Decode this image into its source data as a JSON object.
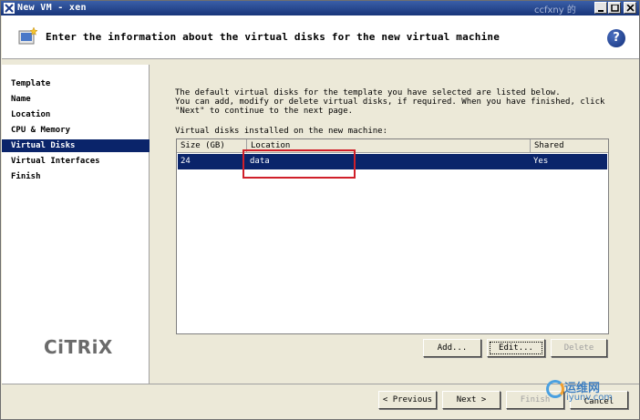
{
  "window": {
    "title": "New VM - xen",
    "watermark_top": "ccfxny 的"
  },
  "header": {
    "heading": "Enter the information about the virtual disks for the new virtual machine",
    "help_label": "?"
  },
  "nav": {
    "items": [
      {
        "label": "Template",
        "active": false
      },
      {
        "label": "Name",
        "active": false
      },
      {
        "label": "Location",
        "active": false
      },
      {
        "label": "CPU & Memory",
        "active": false
      },
      {
        "label": "Virtual Disks",
        "active": true
      },
      {
        "label": "Virtual Interfaces",
        "active": false
      },
      {
        "label": "Finish",
        "active": false
      }
    ],
    "logo": "CiTRiX"
  },
  "main": {
    "intro_lines": [
      "The default virtual disks for the template you have selected are listed below.",
      "You can add, modify or delete virtual disks, if required. When you have finished, click",
      "\"Next\" to continue to the next page."
    ],
    "list_label": "Virtual disks installed on the new machine:",
    "columns": [
      "Size (GB)",
      "Location",
      "Shared"
    ],
    "rows": [
      {
        "size": "24",
        "location": "data",
        "shared": "Yes",
        "selected": true
      }
    ]
  },
  "buttons": {
    "add": "Add...",
    "edit": "Edit...",
    "delete": "Delete",
    "previous": "< Previous",
    "next": "Next >",
    "finish": "Finish",
    "cancel": "Cancel"
  },
  "watermark": {
    "cn": "运维网",
    "site": "iyunv.com"
  },
  "colors": {
    "selection": "#0a246a",
    "titlebar": "#18357a",
    "highlight_box": "#d0202a"
  }
}
